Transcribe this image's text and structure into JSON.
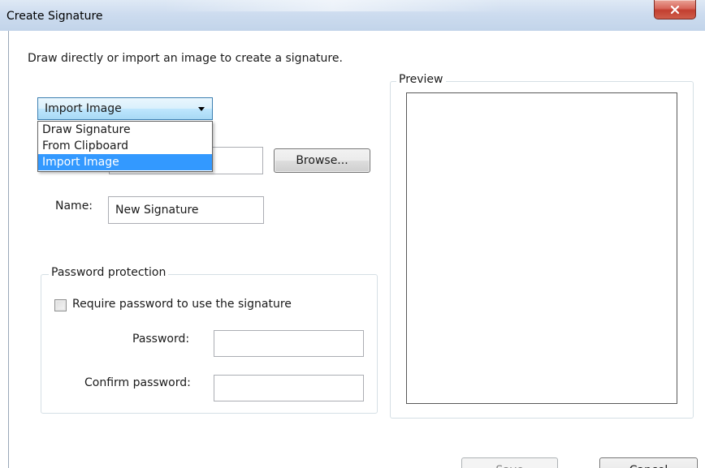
{
  "window": {
    "title": "Create Signature",
    "close_glyph": "x"
  },
  "instructions": "Draw directly or import an image to create a signature.",
  "mode_select": {
    "selected": "Import Image",
    "options": [
      "Draw Signature",
      "From Clipboard",
      "Import Image"
    ],
    "selected_index": 2
  },
  "file": {
    "browse_label": "Browse..."
  },
  "name": {
    "label": "Name:",
    "value": "New Signature"
  },
  "password_protection": {
    "legend": "Password protection",
    "require_label": "Require password to use the signature",
    "require_checked": false,
    "password_label": "Password:",
    "password_value": "",
    "confirm_label": "Confirm password:",
    "confirm_value": ""
  },
  "preview": {
    "legend": "Preview"
  },
  "buttons": {
    "save": "Save",
    "cancel": "Cancel"
  },
  "colors": {
    "selection": "#3399ff",
    "close_button": "#c23f30"
  }
}
